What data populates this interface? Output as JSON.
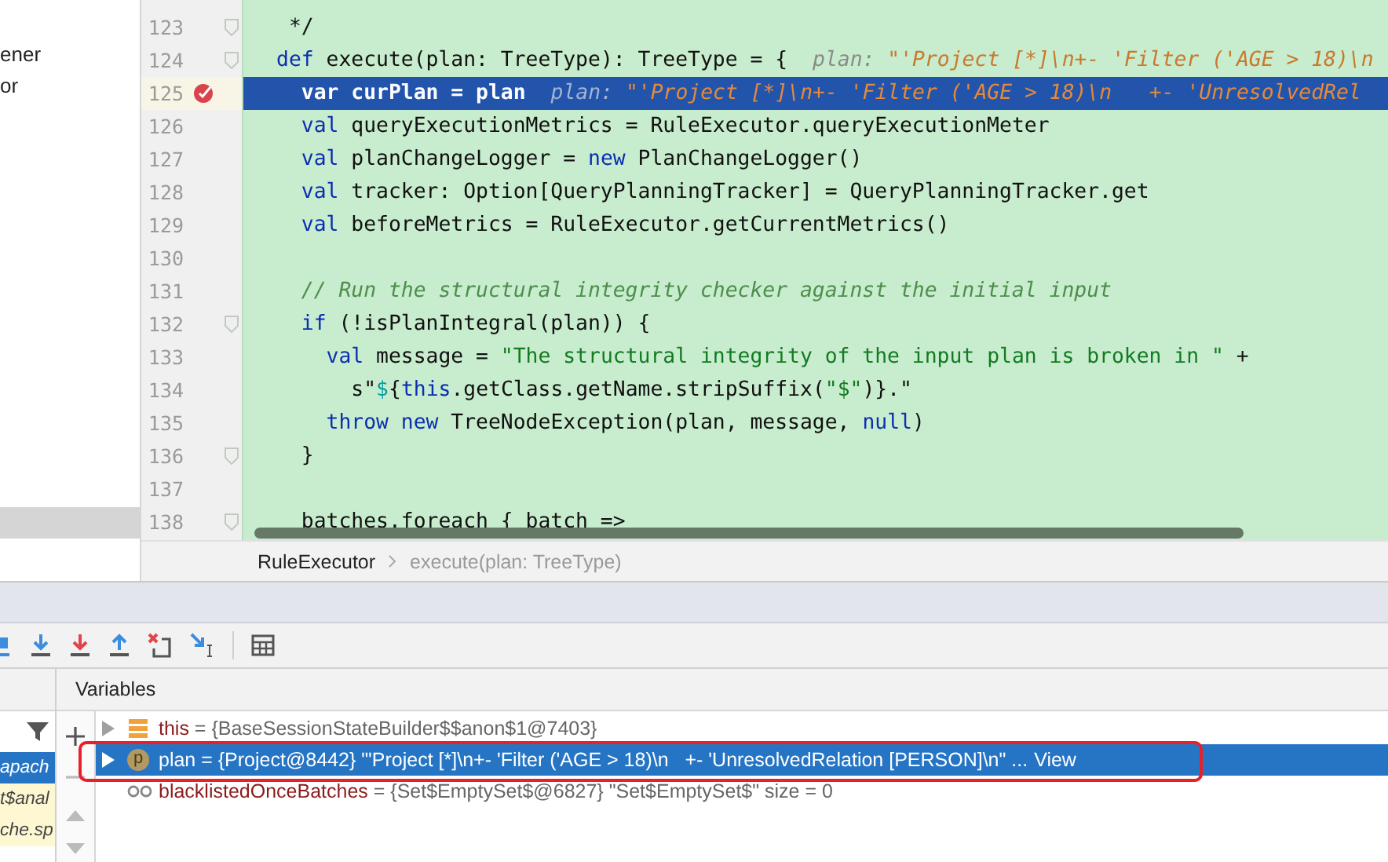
{
  "project_tree": {
    "items": [
      {
        "label": "ener",
        "selected": false
      },
      {
        "label": "or",
        "selected": false
      },
      {
        "selected": true
      }
    ]
  },
  "editor": {
    "lines": [
      {
        "number": "123",
        "fold": true,
        "code": [
          {
            "kind": "plain",
            "text": " */"
          }
        ]
      },
      {
        "number": "124",
        "fold": true,
        "code": [
          {
            "kind": "keyword",
            "text": "def"
          },
          {
            "kind": "plain",
            "text": " execute(plan: TreeType): TreeType = {"
          }
        ],
        "hint": {
          "name": "plan: ",
          "value": "\"'Project [*]\\n+- 'Filter ('AGE > 18)\\n"
        }
      },
      {
        "number": "125",
        "current": true,
        "breakpoint": true,
        "code": [
          {
            "kind": "keyword",
            "text": "  var"
          },
          {
            "kind": "plain",
            "text": " curPlan = plan"
          }
        ],
        "hint": {
          "name": "plan: ",
          "value": "\"'Project [*]\\n+- 'Filter ('AGE > 18)\\n   +- 'UnresolvedRel"
        }
      },
      {
        "number": "126",
        "code": [
          {
            "kind": "keyword",
            "text": "  val"
          },
          {
            "kind": "plain",
            "text": " queryExecutionMetrics = RuleExecutor.queryExecutionMeter"
          }
        ]
      },
      {
        "number": "127",
        "code": [
          {
            "kind": "keyword",
            "text": "  val"
          },
          {
            "kind": "plain",
            "text": " planChangeLogger = "
          },
          {
            "kind": "keyword",
            "text": "new"
          },
          {
            "kind": "plain",
            "text": " PlanChangeLogger()"
          }
        ]
      },
      {
        "number": "128",
        "code": [
          {
            "kind": "keyword",
            "text": "  val"
          },
          {
            "kind": "plain",
            "text": " tracker: Option[QueryPlanningTracker] = QueryPlanningTracker.get"
          }
        ]
      },
      {
        "number": "129",
        "code": [
          {
            "kind": "keyword",
            "text": "  val"
          },
          {
            "kind": "plain",
            "text": " beforeMetrics = RuleExecutor.getCurrentMetrics()"
          }
        ]
      },
      {
        "number": "130"
      },
      {
        "number": "131",
        "code": [
          {
            "kind": "comment",
            "text": "  // Run the structural integrity checker against the initial input"
          }
        ]
      },
      {
        "number": "132",
        "fold": true,
        "code": [
          {
            "kind": "keyword",
            "text": "  if"
          },
          {
            "kind": "plain",
            "text": " (!isPlanIntegral(plan)) {"
          }
        ]
      },
      {
        "number": "133",
        "code": [
          {
            "kind": "keyword",
            "text": "    val"
          },
          {
            "kind": "plain",
            "text": " message = "
          },
          {
            "kind": "string",
            "text": "\"The structural integrity of the input plan is broken in \""
          },
          {
            "kind": "plain",
            "text": " +"
          }
        ]
      },
      {
        "number": "134",
        "code": [
          {
            "kind": "plain",
            "text": "      s\""
          },
          {
            "kind": "interpolation",
            "text": "$"
          },
          {
            "kind": "plain",
            "text": "{"
          },
          {
            "kind": "keyword",
            "text": "this"
          },
          {
            "kind": "plain",
            "text": ".getClass.getName.stripSuffix("
          },
          {
            "kind": "string",
            "text": "\"$\""
          },
          {
            "kind": "plain",
            "text": ")}.\""
          }
        ]
      },
      {
        "number": "135",
        "code": [
          {
            "kind": "keyword",
            "text": "    throw"
          },
          {
            "kind": "keyword",
            "text": " new"
          },
          {
            "kind": "plain",
            "text": " TreeNodeException(plan, message, "
          },
          {
            "kind": "keyword",
            "text": "null"
          },
          {
            "kind": "plain",
            "text": ")"
          }
        ]
      },
      {
        "number": "136",
        "fold": true,
        "code": [
          {
            "kind": "plain",
            "text": "  }"
          }
        ]
      },
      {
        "number": "137"
      },
      {
        "number": "138",
        "fold": true,
        "code": [
          {
            "kind": "plain",
            "text": "  batches.foreach { batch =>"
          }
        ]
      }
    ]
  },
  "breadcrumb": [
    "RuleExecutor",
    "execute(plan: TreeType)"
  ],
  "debugger": {
    "frames": [
      {
        "label": "apach",
        "selected": true,
        "library": false
      },
      {
        "label": "t$anal",
        "selected": false,
        "library": true
      },
      {
        "label": "che.sp",
        "selected": false,
        "library": true
      }
    ],
    "variables_title": "Variables",
    "variables": [
      {
        "kind": "field",
        "expandable": true,
        "selected": false,
        "name": "this",
        "value": " = {BaseSessionStateBuilder$$anon$1@7403}"
      },
      {
        "kind": "param",
        "badge": "p",
        "expandable": true,
        "selected": true,
        "name": "plan",
        "value": " = {Project@8442} \"'Project [*]\\n+- 'Filter ('AGE > 18)\\n   +- 'UnresolvedRelation [PERSON]\\n\" ...",
        "link": "View"
      },
      {
        "kind": "watch",
        "expandable": false,
        "selected": false,
        "name": "blacklistedOnceBatches",
        "value": " = {Set$EmptySet$@6827} \"Set$EmptySet$\" size = 0"
      }
    ]
  }
}
